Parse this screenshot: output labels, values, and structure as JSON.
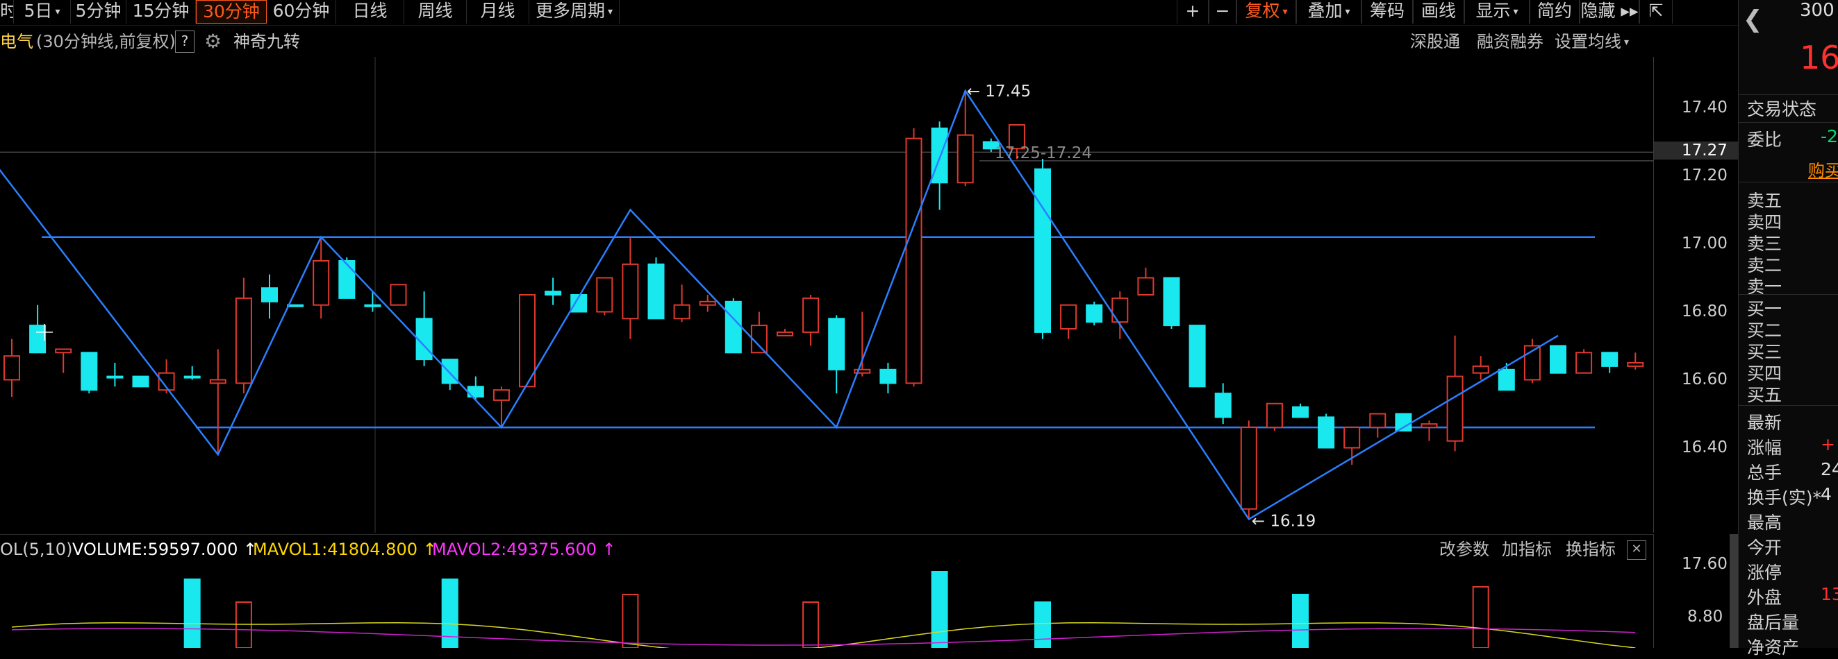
{
  "toolbar": {
    "left_items": [
      {
        "label": "时",
        "active": false,
        "caret": false
      },
      {
        "label": "5日",
        "active": false,
        "caret": true
      },
      {
        "label": "5分钟",
        "active": false,
        "caret": false
      },
      {
        "label": "15分钟",
        "active": false,
        "caret": false
      },
      {
        "label": "30分钟",
        "active": true,
        "caret": false
      },
      {
        "label": "60分钟",
        "active": false,
        "caret": false
      },
      {
        "label": "日线",
        "active": false,
        "caret": false
      },
      {
        "label": "周线",
        "active": false,
        "caret": false
      },
      {
        "label": "月线",
        "active": false,
        "caret": false
      },
      {
        "label": "更多周期",
        "active": false,
        "caret": true
      }
    ],
    "right_items": [
      {
        "label": "+",
        "orange": false,
        "caret": false
      },
      {
        "label": "−",
        "orange": false,
        "caret": false
      },
      {
        "label": "复权",
        "orange": true,
        "caret": true
      },
      {
        "label": "叠加",
        "orange": false,
        "caret": true
      },
      {
        "label": "筹码",
        "orange": false,
        "caret": false
      },
      {
        "label": "画线",
        "orange": false,
        "caret": false
      },
      {
        "label": "显示",
        "orange": false,
        "caret": true
      },
      {
        "label": "简约",
        "orange": false,
        "caret": false
      },
      {
        "label": "隐藏 ▸▸",
        "orange": false,
        "caret": false
      },
      {
        "label": "⇱",
        "orange": false,
        "caret": false
      }
    ]
  },
  "infobar": {
    "stock_name": "电气",
    "period_desc": "(30分钟线,前复权)",
    "help": "?",
    "indicator": "神奇九转",
    "right_links": [
      "深股通",
      "融资融券",
      "设置均线"
    ]
  },
  "chart_data": {
    "type": "candlestick",
    "y_axis_labels": [
      "17.40",
      "17.20",
      "17.00",
      "16.80",
      "16.60",
      "16.40"
    ],
    "current_price_label": "17.27",
    "annotations": {
      "high": "17.45",
      "low": "16.19",
      "range": "17.25-17.24"
    },
    "candles": [
      {
        "o": 16.6,
        "h": 16.72,
        "l": 16.55,
        "c": 16.67
      },
      {
        "o": 16.76,
        "h": 16.82,
        "l": 16.7,
        "c": 16.68
      },
      {
        "o": 16.68,
        "h": 16.69,
        "l": 16.62,
        "c": 16.69
      },
      {
        "o": 16.68,
        "h": 16.68,
        "l": 16.56,
        "c": 16.57
      },
      {
        "o": 16.61,
        "h": 16.65,
        "l": 16.58,
        "c": 16.61
      },
      {
        "o": 16.61,
        "h": 16.61,
        "l": 16.58,
        "c": 16.58
      },
      {
        "o": 16.57,
        "h": 16.66,
        "l": 16.56,
        "c": 16.62
      },
      {
        "o": 16.61,
        "h": 16.64,
        "l": 16.6,
        "c": 16.61
      },
      {
        "o": 16.59,
        "h": 16.69,
        "l": 16.38,
        "c": 16.6
      },
      {
        "o": 16.59,
        "h": 16.9,
        "l": 16.56,
        "c": 16.84
      },
      {
        "o": 16.87,
        "h": 16.91,
        "l": 16.78,
        "c": 16.83
      },
      {
        "o": 16.82,
        "h": 16.82,
        "l": 16.82,
        "c": 16.82
      },
      {
        "o": 16.82,
        "h": 17.02,
        "l": 16.78,
        "c": 16.95
      },
      {
        "o": 16.95,
        "h": 16.96,
        "l": 16.84,
        "c": 16.84
      },
      {
        "o": 16.82,
        "h": 16.86,
        "l": 16.8,
        "c": 16.82
      },
      {
        "o": 16.82,
        "h": 16.88,
        "l": 16.82,
        "c": 16.88
      },
      {
        "o": 16.78,
        "h": 16.86,
        "l": 16.64,
        "c": 16.66
      },
      {
        "o": 16.66,
        "h": 16.66,
        "l": 16.57,
        "c": 16.59
      },
      {
        "o": 16.58,
        "h": 16.61,
        "l": 16.54,
        "c": 16.55
      },
      {
        "o": 16.54,
        "h": 16.58,
        "l": 16.46,
        "c": 16.57
      },
      {
        "o": 16.58,
        "h": 16.85,
        "l": 16.58,
        "c": 16.85
      },
      {
        "o": 16.86,
        "h": 16.9,
        "l": 16.82,
        "c": 16.85
      },
      {
        "o": 16.85,
        "h": 16.85,
        "l": 16.8,
        "c": 16.8
      },
      {
        "o": 16.8,
        "h": 16.9,
        "l": 16.79,
        "c": 16.9
      },
      {
        "o": 16.78,
        "h": 17.02,
        "l": 16.72,
        "c": 16.94
      },
      {
        "o": 16.94,
        "h": 16.96,
        "l": 16.78,
        "c": 16.78
      },
      {
        "o": 16.78,
        "h": 16.88,
        "l": 16.77,
        "c": 16.82
      },
      {
        "o": 16.82,
        "h": 16.85,
        "l": 16.8,
        "c": 16.83
      },
      {
        "o": 16.83,
        "h": 16.84,
        "l": 16.68,
        "c": 16.68
      },
      {
        "o": 16.68,
        "h": 16.8,
        "l": 16.68,
        "c": 16.76
      },
      {
        "o": 16.73,
        "h": 16.75,
        "l": 16.73,
        "c": 16.74
      },
      {
        "o": 16.74,
        "h": 16.85,
        "l": 16.7,
        "c": 16.84
      },
      {
        "o": 16.78,
        "h": 16.79,
        "l": 16.56,
        "c": 16.63
      },
      {
        "o": 16.62,
        "h": 16.8,
        "l": 16.61,
        "c": 16.63
      },
      {
        "o": 16.63,
        "h": 16.65,
        "l": 16.56,
        "c": 16.59
      },
      {
        "o": 16.59,
        "h": 17.34,
        "l": 16.58,
        "c": 17.31
      },
      {
        "o": 17.34,
        "h": 17.36,
        "l": 17.1,
        "c": 17.18
      },
      {
        "o": 17.18,
        "h": 17.45,
        "l": 17.17,
        "c": 17.32
      },
      {
        "o": 17.3,
        "h": 17.31,
        "l": 17.27,
        "c": 17.28
      },
      {
        "o": 17.28,
        "h": 17.35,
        "l": 17.25,
        "c": 17.35
      },
      {
        "o": 17.22,
        "h": 17.25,
        "l": 16.72,
        "c": 16.74
      },
      {
        "o": 16.75,
        "h": 16.82,
        "l": 16.72,
        "c": 16.82
      },
      {
        "o": 16.82,
        "h": 16.83,
        "l": 16.76,
        "c": 16.77
      },
      {
        "o": 16.77,
        "h": 16.86,
        "l": 16.72,
        "c": 16.84
      },
      {
        "o": 16.85,
        "h": 16.93,
        "l": 16.85,
        "c": 16.9
      },
      {
        "o": 16.9,
        "h": 16.9,
        "l": 16.75,
        "c": 16.76
      },
      {
        "o": 16.76,
        "h": 16.76,
        "l": 16.58,
        "c": 16.58
      },
      {
        "o": 16.56,
        "h": 16.59,
        "l": 16.47,
        "c": 16.49
      },
      {
        "o": 16.22,
        "h": 16.48,
        "l": 16.19,
        "c": 16.46
      },
      {
        "o": 16.46,
        "h": 16.53,
        "l": 16.45,
        "c": 16.53
      },
      {
        "o": 16.52,
        "h": 16.53,
        "l": 16.49,
        "c": 16.49
      },
      {
        "o": 16.49,
        "h": 16.5,
        "l": 16.4,
        "c": 16.4
      },
      {
        "o": 16.4,
        "h": 16.46,
        "l": 16.35,
        "c": 16.46
      },
      {
        "o": 16.46,
        "h": 16.5,
        "l": 16.43,
        "c": 16.5
      },
      {
        "o": 16.5,
        "h": 16.5,
        "l": 16.45,
        "c": 16.45
      },
      {
        "o": 16.46,
        "h": 16.48,
        "l": 16.42,
        "c": 16.47
      },
      {
        "o": 16.42,
        "h": 16.73,
        "l": 16.39,
        "c": 16.61
      },
      {
        "o": 16.62,
        "h": 16.67,
        "l": 16.6,
        "c": 16.64
      },
      {
        "o": 16.63,
        "h": 16.65,
        "l": 16.57,
        "c": 16.57
      },
      {
        "o": 16.6,
        "h": 16.72,
        "l": 16.59,
        "c": 16.7
      },
      {
        "o": 16.7,
        "h": 16.7,
        "l": 16.62,
        "c": 16.62
      },
      {
        "o": 16.62,
        "h": 16.69,
        "l": 16.62,
        "c": 16.68
      },
      {
        "o": 16.68,
        "h": 16.68,
        "l": 16.62,
        "c": 16.64
      },
      {
        "o": 16.64,
        "h": 16.68,
        "l": 16.63,
        "c": 16.65
      }
    ],
    "horizontal_lines": [
      17.02,
      16.46
    ],
    "zigzag_points": [
      {
        "i": -1,
        "p": 17.27
      },
      {
        "i": 8,
        "p": 16.38
      },
      {
        "i": 12,
        "p": 17.02
      },
      {
        "i": 19,
        "p": 16.46
      },
      {
        "i": 24,
        "p": 17.1
      },
      {
        "i": 32,
        "p": 16.46
      },
      {
        "i": 37,
        "p": 17.45
      },
      {
        "i": 48,
        "p": 16.19
      },
      {
        "i": 60,
        "p": 16.73
      }
    ]
  },
  "volume": {
    "label_name": "OL(5,10)",
    "volume_text": "VOLUME:59597.000",
    "mavol1_text": "MAVOL1:41804.800",
    "mavol2_text": "MAVOL2:49375.600",
    "arrow": "↑",
    "right_links": [
      "改参数",
      "加指标",
      "换指标"
    ],
    "close_icon_label": "✕",
    "axis_labels": [
      "17.60",
      "8.80"
    ],
    "bars": [
      0,
      0,
      0,
      0,
      0,
      0,
      0,
      9,
      0,
      6,
      0,
      0,
      0,
      0,
      0,
      0,
      0,
      9,
      0,
      0,
      0,
      0,
      0,
      0,
      7,
      0,
      0,
      0,
      0,
      0,
      0,
      6,
      0,
      0,
      0,
      0,
      10,
      0,
      0,
      0,
      6,
      0,
      0,
      0,
      0,
      0,
      0,
      0,
      0,
      0,
      7,
      0,
      0,
      0,
      0,
      0,
      0,
      8,
      0,
      0,
      0,
      0,
      0,
      0
    ]
  },
  "sidebar": {
    "code_partial": "300",
    "price_partial": "16",
    "trade_state": "交易状态",
    "weibi_label": "委比",
    "weibi_value": "-2",
    "buy_button": "购买",
    "sell_levels": [
      "卖五",
      "卖四",
      "卖三",
      "卖二",
      "卖一"
    ],
    "buy_levels": [
      "买一",
      "买二",
      "买三",
      "买四",
      "买五"
    ],
    "stats": [
      {
        "label": "最新",
        "value": ""
      },
      {
        "label": "涨幅",
        "value": "+"
      },
      {
        "label": "总手",
        "value": "24"
      },
      {
        "label": "换手(实)*",
        "value": "4"
      },
      {
        "label": "最高",
        "value": ""
      },
      {
        "label": "今开",
        "value": ""
      },
      {
        "label": "涨停",
        "value": ""
      },
      {
        "label": "外盘",
        "value": "13"
      },
      {
        "label": "盘后量",
        "value": ""
      },
      {
        "label": "净资产",
        "value": ""
      }
    ],
    "colors": {
      "red": "#ff3030",
      "green": "#00e070",
      "orange": "#ff8c00"
    }
  }
}
